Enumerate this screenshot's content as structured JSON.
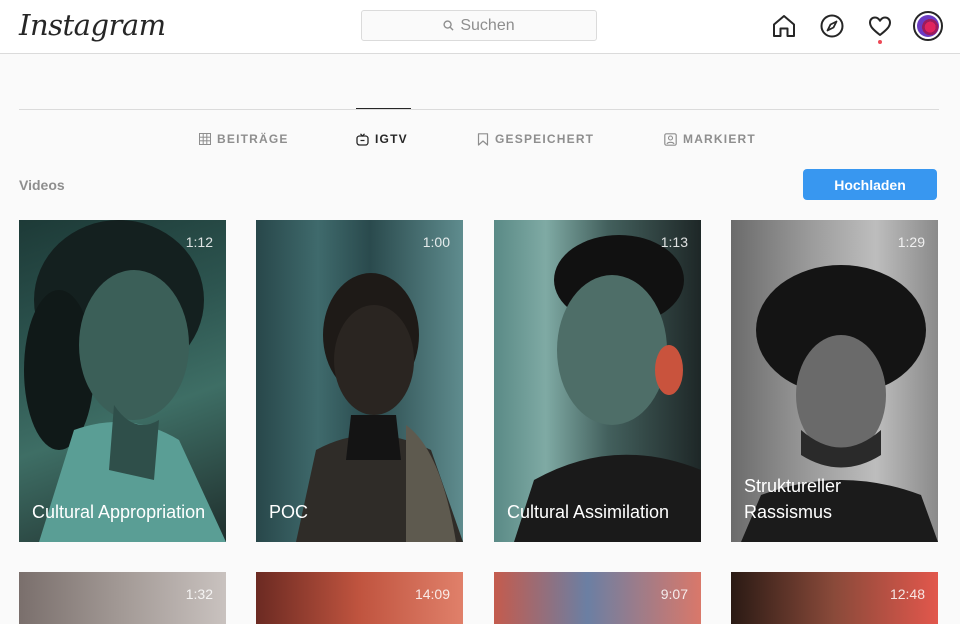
{
  "header": {
    "logo": "Instagram",
    "search_placeholder": "Suchen",
    "icons": [
      "home-icon",
      "explore-compass-icon",
      "activity-heart-icon",
      "profile-avatar"
    ]
  },
  "tabs": [
    {
      "label": "BEITRÄGE",
      "icon": "grid-icon",
      "active": false
    },
    {
      "label": "IGTV",
      "icon": "igtv-icon",
      "active": true
    },
    {
      "label": "GESPEICHERT",
      "icon": "bookmark-icon",
      "active": false
    },
    {
      "label": "MARKIERT",
      "icon": "tagged-person-icon",
      "active": false
    }
  ],
  "section_title": "Videos",
  "upload_label": "Hochladen",
  "videos": [
    {
      "duration": "1:12",
      "title": "Cultural Appropriation"
    },
    {
      "duration": "1:00",
      "title": "POC"
    },
    {
      "duration": "1:13",
      "title": "Cultural Assimilation"
    },
    {
      "duration": "1:29",
      "title": "Struktureller Rassismus"
    },
    {
      "duration": "1:32",
      "title": ""
    },
    {
      "duration": "14:09",
      "title": ""
    },
    {
      "duration": "9:07",
      "title": ""
    },
    {
      "duration": "12:48",
      "title": ""
    }
  ],
  "colors": {
    "accent": "#3897f0",
    "notification": "#ed4956"
  }
}
